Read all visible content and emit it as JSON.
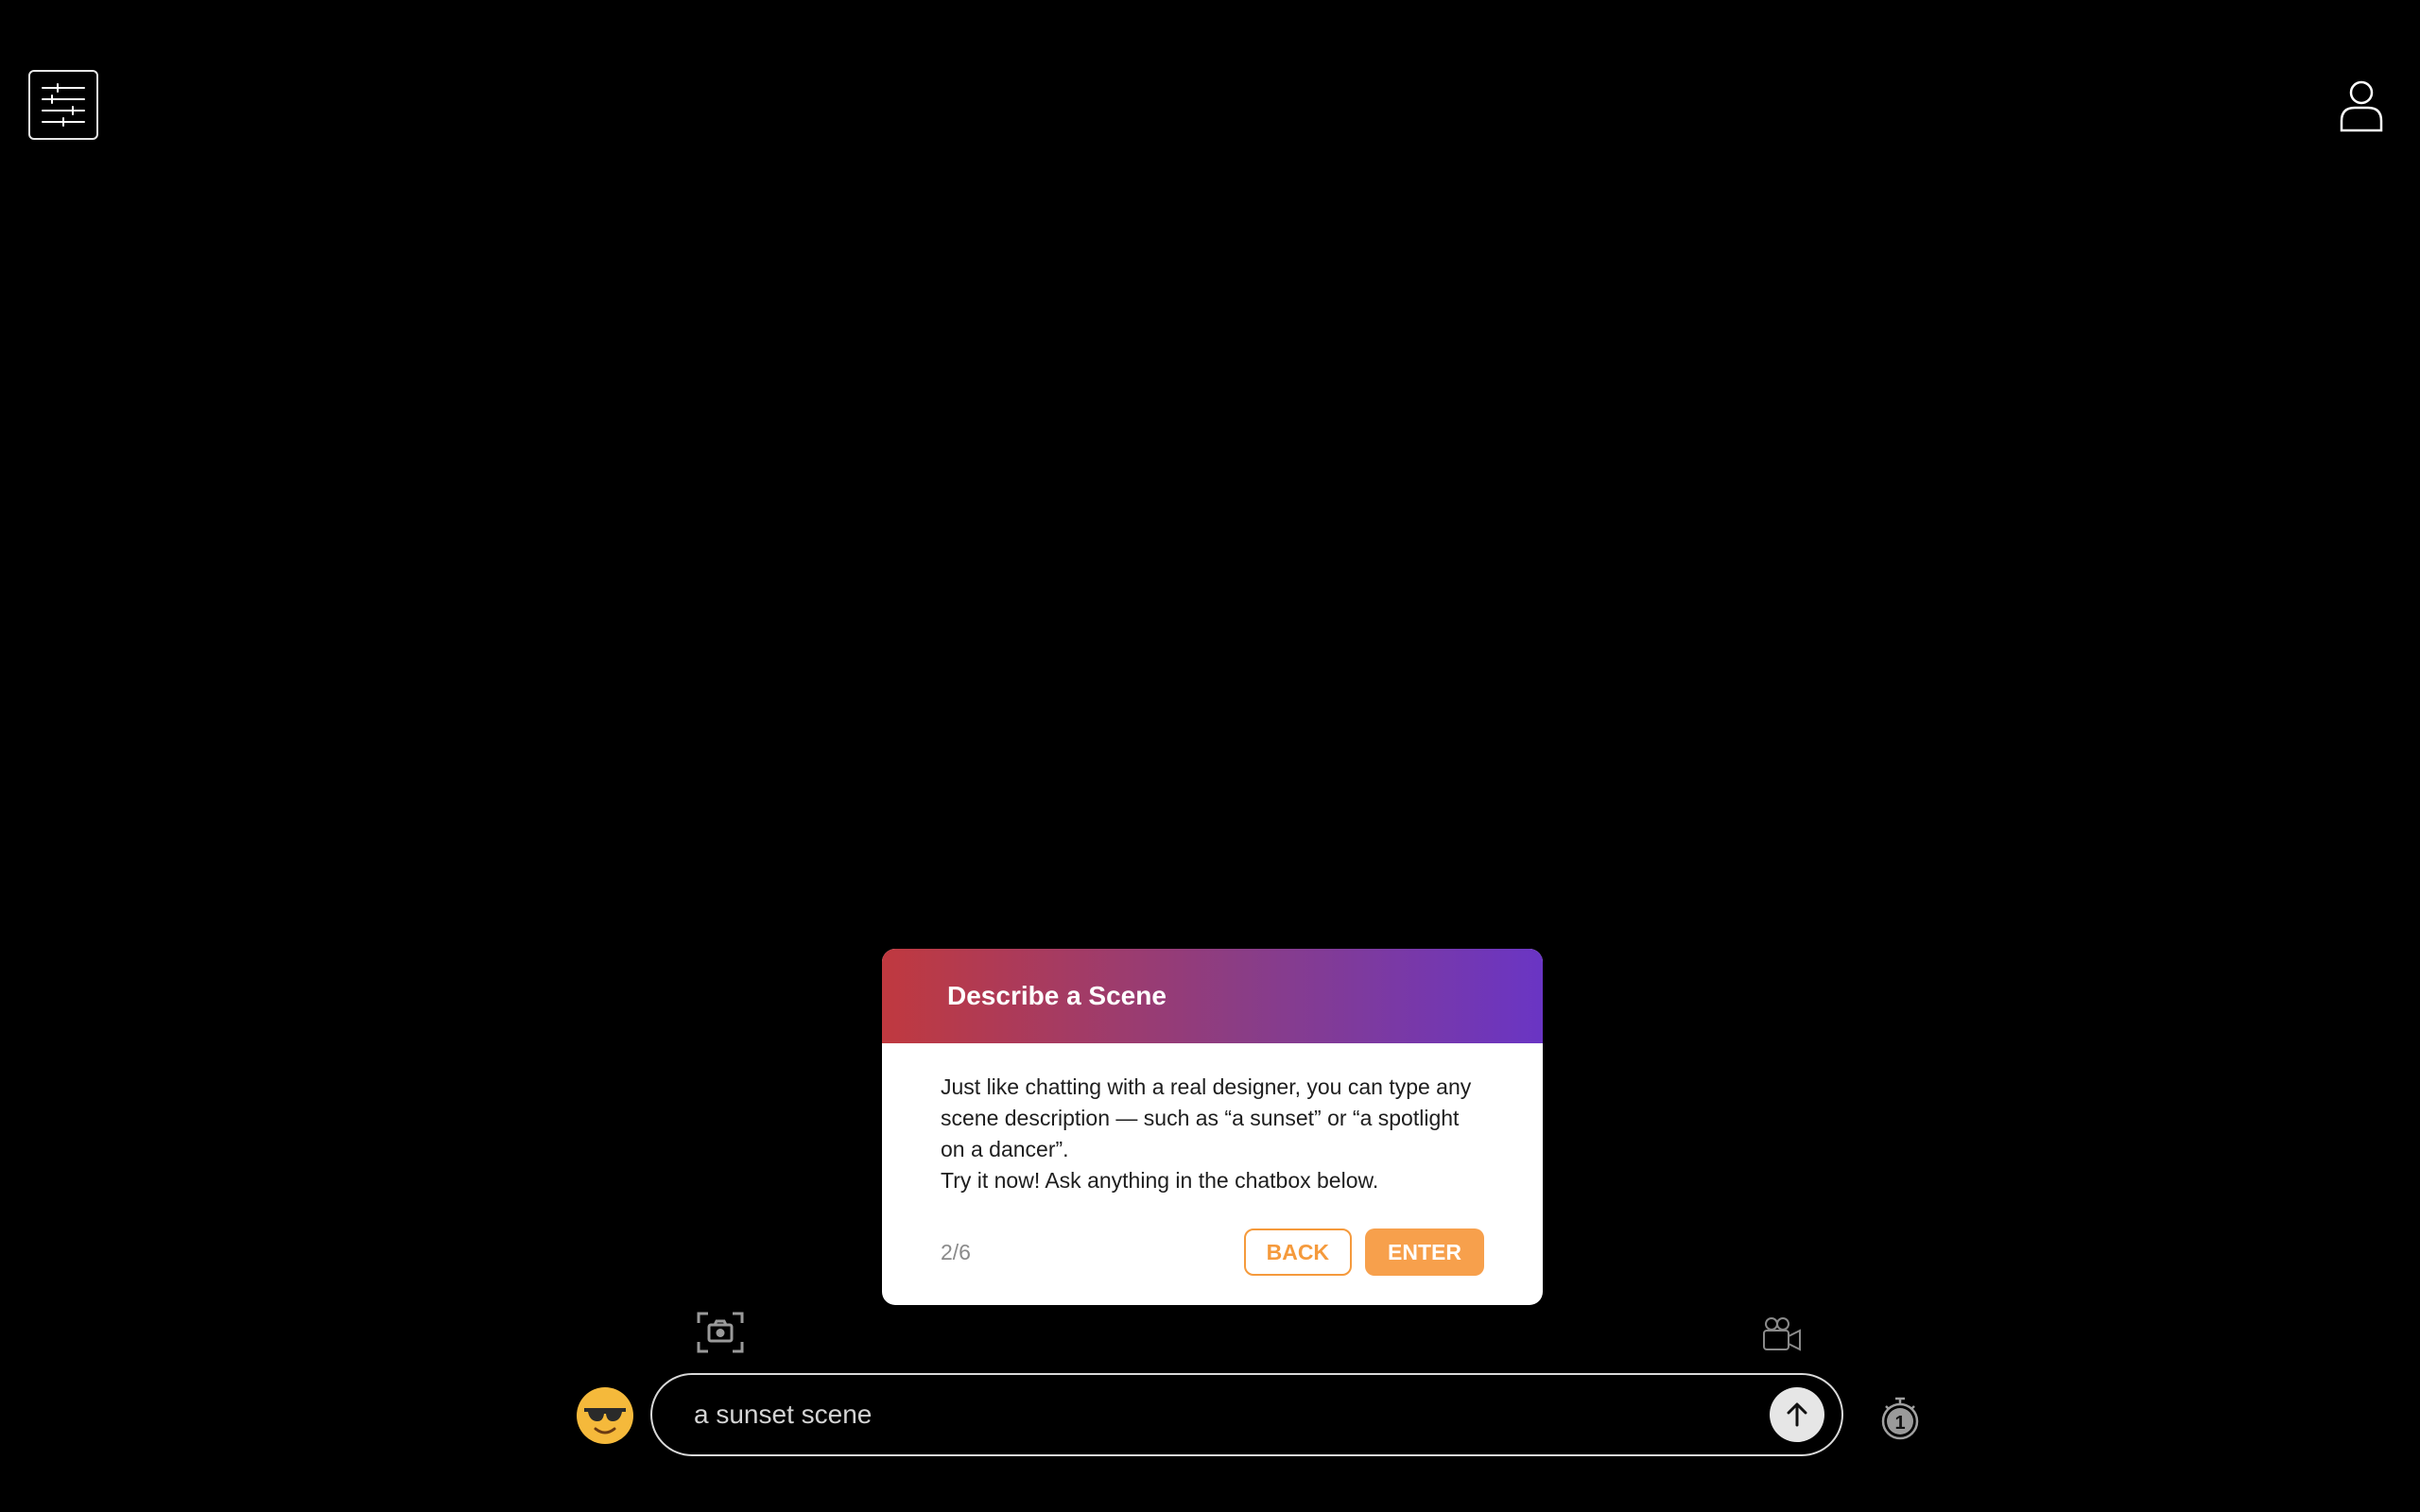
{
  "top_bar": {
    "menu_icon": "sliders-menu-icon",
    "profile_icon": "user-profile-icon"
  },
  "tour": {
    "title": "Describe a Scene",
    "body_line1": "Just like chatting with a real designer, you can type any scene description — such as “a sunset” or “a spotlight on a dancer”.",
    "body_line2": "Try it now! Ask anything in the chatbox below.",
    "step": "2/6",
    "back_label": "BACK",
    "enter_label": "ENTER",
    "colors": {
      "gradient_start": "#c0393f",
      "gradient_end": "#6a35c4",
      "accent": "#f7a04c"
    }
  },
  "toolbar": {
    "camera_icon": "camera-capture-icon",
    "video_icon": "video-camera-icon"
  },
  "chat": {
    "emoji_icon": "sunglasses-face-icon",
    "input_value": "a sunset scene",
    "send_icon": "arrow-up-icon",
    "timer_icon": "stopwatch-icon",
    "timer_value": "1"
  }
}
